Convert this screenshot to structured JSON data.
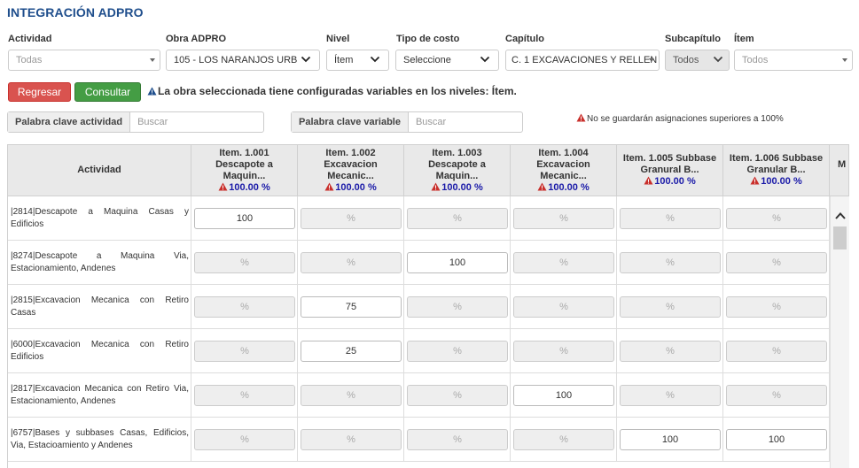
{
  "page_title": "INTEGRACIÓN ADPRO",
  "filters": {
    "actividad": {
      "label": "Actividad",
      "placeholder": "Todas"
    },
    "obra": {
      "label": "Obra ADPRO",
      "value": "105 - LOS NARANJOS URB"
    },
    "nivel": {
      "label": "Nivel",
      "value": "Ítem"
    },
    "tipo_costo": {
      "label": "Tipo de costo",
      "value": "Seleccione"
    },
    "capitulo": {
      "label": "Capítulo",
      "value": "C. 1 EXCAVACIONES Y RELLEN"
    },
    "subcapitulo": {
      "label": "Subcapítulo",
      "value": "Todos"
    },
    "item": {
      "label": "Ítem",
      "placeholder": "Todos"
    }
  },
  "buttons": {
    "regresar": "Regresar",
    "consultar": "Consultar"
  },
  "notice": "La obra seleccionada tiene configuradas variables en los niveles: Ítem.",
  "search": {
    "actividad_label": "Palabra clave actividad",
    "actividad_placeholder": "Buscar",
    "variable_label": "Palabra clave variable",
    "variable_placeholder": "Buscar"
  },
  "warning_limit": "No se guardarán asignaciones superiores a 100%",
  "table": {
    "activity_header": "Actividad",
    "more_header": "M",
    "columns": [
      {
        "line1": "Item. 1.001",
        "line2": "Descapote a",
        "line3": "Maquin...",
        "pct": "100.00 %"
      },
      {
        "line1": "Item. 1.002",
        "line2": "Excavacion",
        "line3": "Mecanic...",
        "pct": "100.00 %"
      },
      {
        "line1": "Item. 1.003",
        "line2": "Descapote a",
        "line3": "Maquin...",
        "pct": "100.00 %"
      },
      {
        "line1": "Item. 1.004",
        "line2": "Excavacion",
        "line3": "Mecanic...",
        "pct": "100.00 %"
      },
      {
        "line1": "Item. 1.005 Subbase",
        "line2": "Granural B...",
        "line3": "",
        "pct": "100.00 %"
      },
      {
        "line1": "Item. 1.006 Subbase",
        "line2": "Granular B...",
        "line3": "",
        "pct": "100.00 %"
      }
    ],
    "input_placeholder": "%",
    "rows": [
      {
        "activity": "|2814|Descapote a Maquina Casas y Edificios",
        "values": [
          "100",
          "",
          "",
          "",
          "",
          ""
        ]
      },
      {
        "activity": "|8274|Descapote a Maquina Via, Estacionamiento, Andenes",
        "values": [
          "",
          "",
          "100",
          "",
          "",
          ""
        ]
      },
      {
        "activity": "|2815|Excavacion Mecanica con Retiro Casas",
        "values": [
          "",
          "75",
          "",
          "",
          "",
          ""
        ]
      },
      {
        "activity": "|6000|Excavacion Mecanica con Retiro Edificios",
        "values": [
          "",
          "25",
          "",
          "",
          "",
          ""
        ]
      },
      {
        "activity": "|2817|Excavacion Mecanica con Retiro Via, Estacionamiento, Andenes",
        "values": [
          "",
          "",
          "",
          "100",
          "",
          ""
        ]
      },
      {
        "activity": "|6757|Bases y subbases Casas, Edificios, Via, Estacioamiento y Andenes",
        "values": [
          "",
          "",
          "",
          "",
          "100",
          "100"
        ]
      }
    ]
  },
  "colors": {
    "title": "#1f4e8c",
    "danger": "#d9534f",
    "success": "#449d44",
    "pct_text": "#1a1aa8",
    "warning_icon": "#c9302c"
  }
}
